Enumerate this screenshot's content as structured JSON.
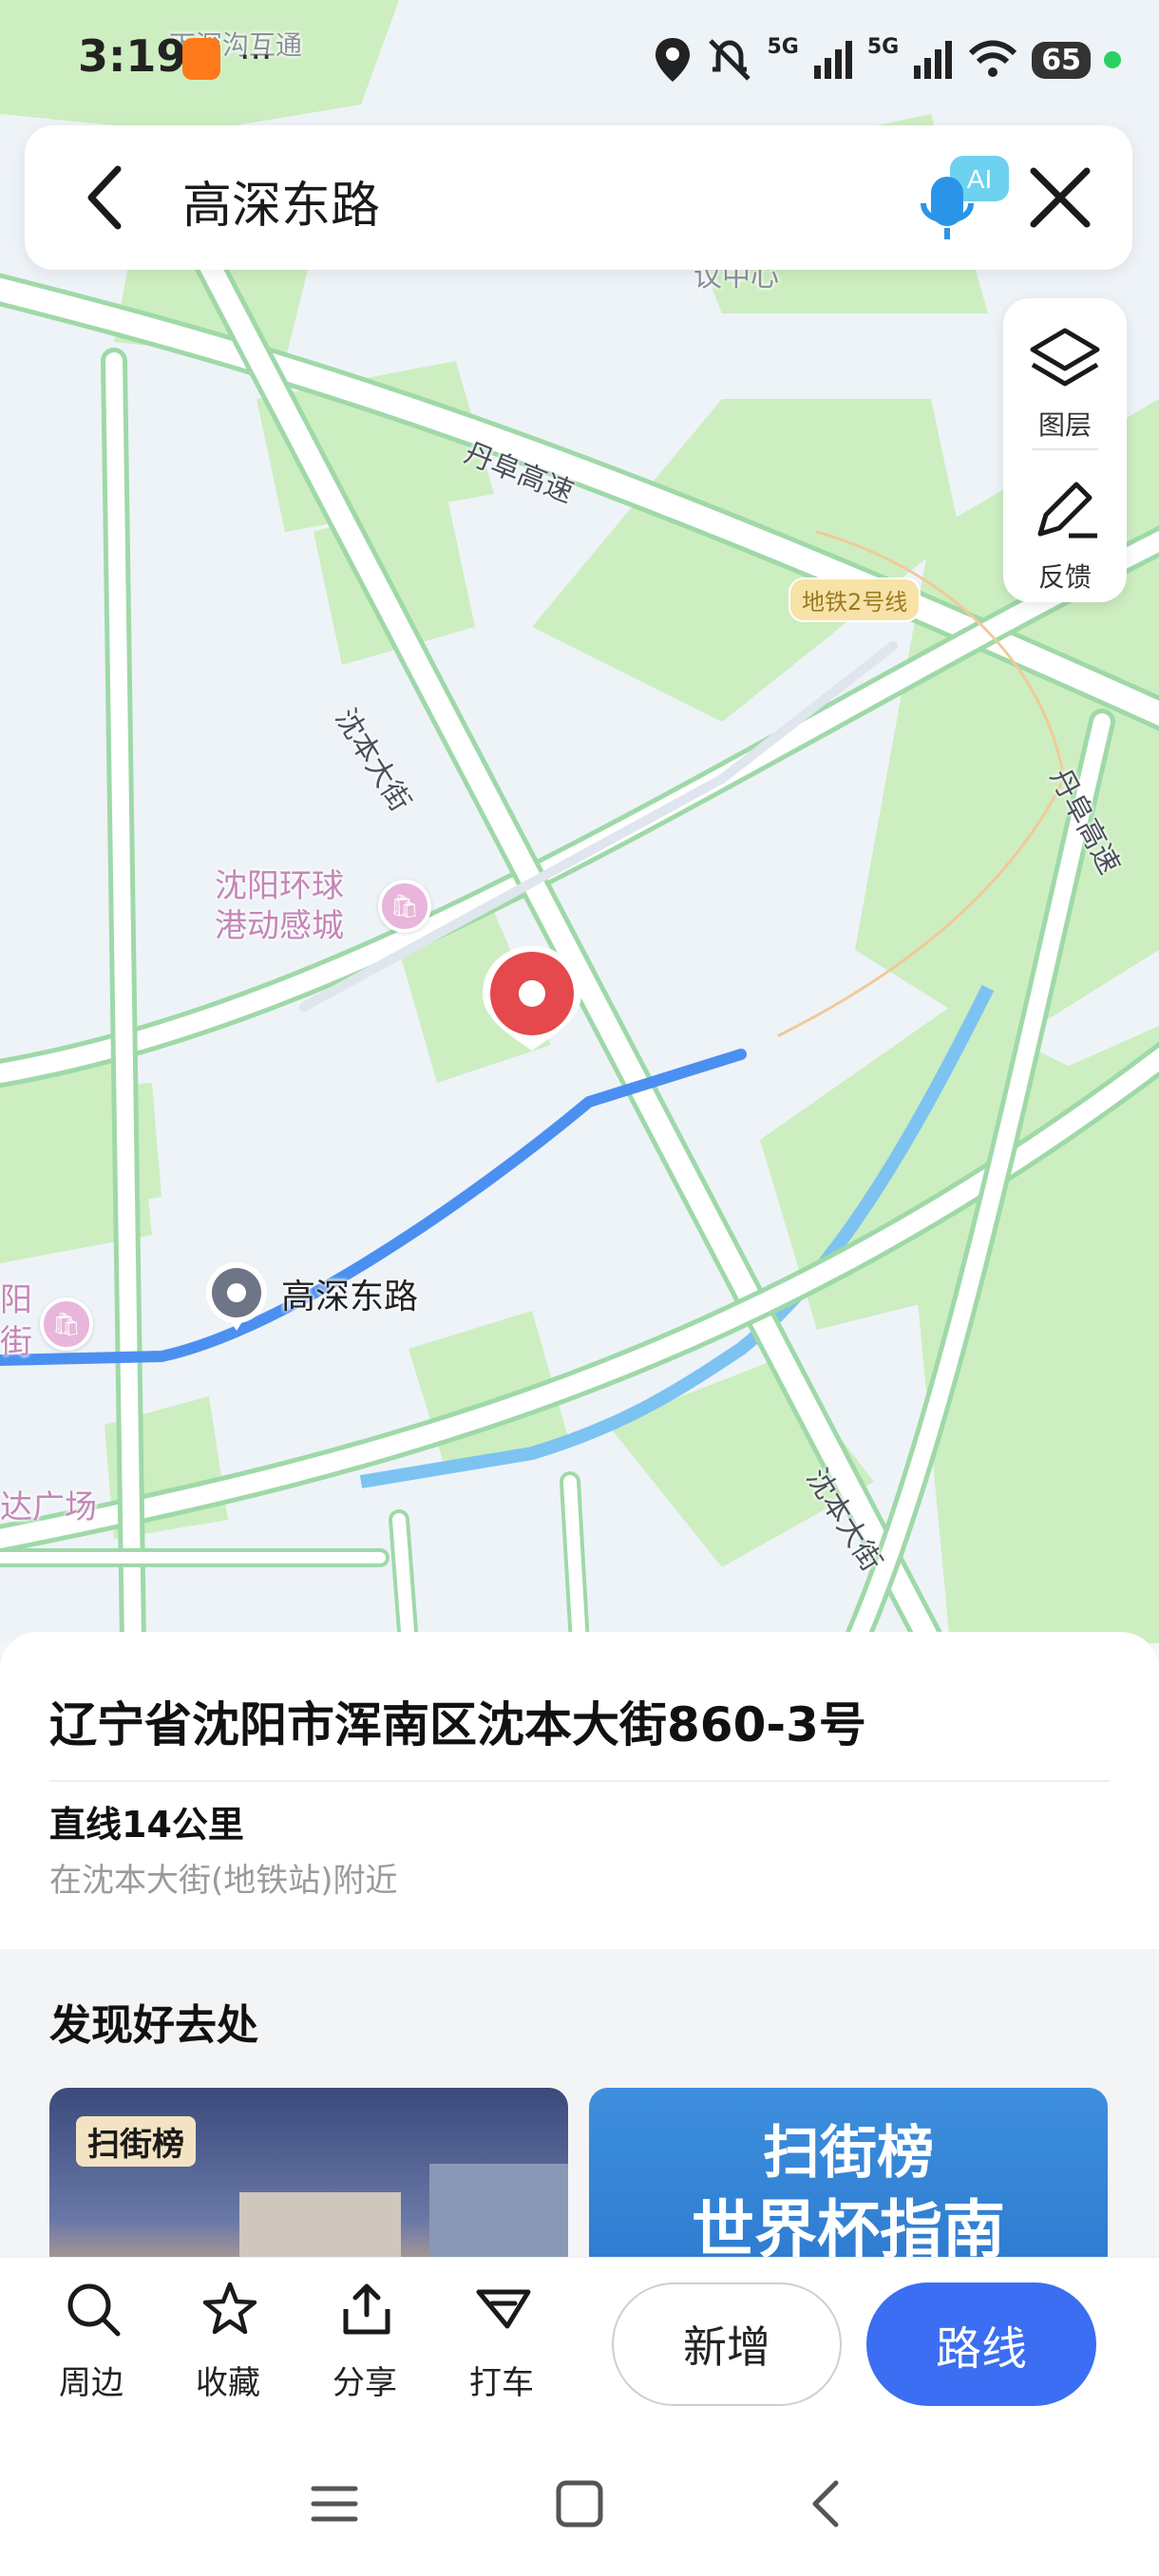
{
  "status_bar": {
    "time": "3:19",
    "notification_dots": "···",
    "battery": "65",
    "signal1": "5G",
    "signal2": "5G"
  },
  "search": {
    "query": "高深东路",
    "ai_label": "AI"
  },
  "side_tools": {
    "layers_label": "图层",
    "feedback_label": "反馈"
  },
  "map": {
    "labels": {
      "top_faded": "下深沟互通",
      "top_center": "议中心",
      "highway": "丹阜高速",
      "subway": "地铁2号线",
      "street_upper": "沈本大街",
      "street_lower": "沈本大街",
      "right_highway": "丹阜高速",
      "mall_line1": "沈阳环球",
      "mall_line2": "港动感城",
      "left_mall": "达广场",
      "left_edge1": "阳",
      "left_edge2": "街"
    },
    "poi_label": "高深东路",
    "colors": {
      "route": "#4b90f0",
      "pin": "#e5484d",
      "green": "#cdeec0",
      "road_edge": "#9fd9a8"
    }
  },
  "place": {
    "address": "辽宁省沈阳市浑南区沈本大街860-3号",
    "distance": "直线14公里",
    "nearby": "在沈本大街(地铁站)附近"
  },
  "discover": {
    "title": "发现好去处",
    "card1_tag": "扫街榜",
    "card2_line1": "扫街榜",
    "card2_line2": "世界杯指南"
  },
  "actions": {
    "nearby": "周边",
    "favorite": "收藏",
    "share": "分享",
    "taxi": "打车",
    "add": "新增",
    "route": "路线"
  }
}
